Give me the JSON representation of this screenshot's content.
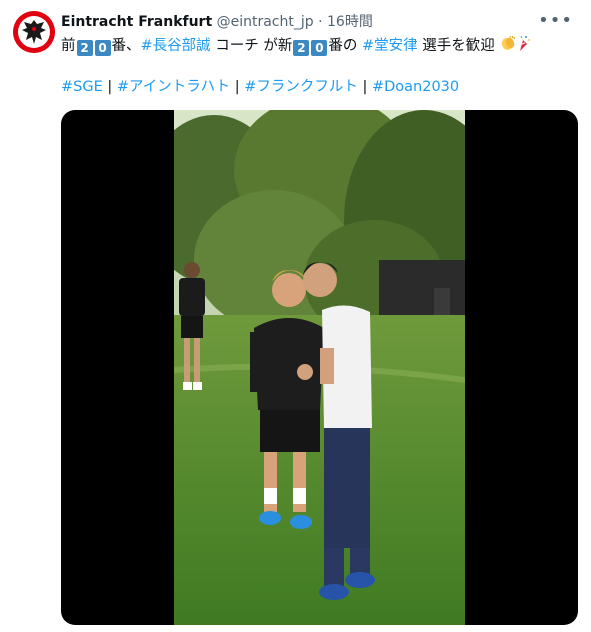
{
  "tweet": {
    "author_name": "Eintracht Frankfurt",
    "author_handle": "@eintracht_jp",
    "separator": "·",
    "timestamp": "16時間",
    "text": {
      "p1": "前",
      "n1a": "2",
      "n1b": "0",
      "p2": "番、",
      "tag1": "#長谷部誠",
      "p3": " コーチ が新",
      "n2a": "2",
      "n2b": "0",
      "p4": "番の ",
      "tag2": "#堂安律",
      "p5": " 選手を歓迎"
    },
    "hashtags": [
      "#SGE",
      "#アイントラハト",
      "#フランクフルト",
      "#Doan2030"
    ],
    "hashtag_separator": " | "
  },
  "icons": {
    "avatar": "eintracht-eagle-logo",
    "more": "more-options-icon",
    "emoji_clap": "clapping-hands-emoji",
    "emoji_party": "party-popper-emoji"
  },
  "colors": {
    "link": "#1d9bf0",
    "brand_red": "#e1000f",
    "keycap": "#3b88c3",
    "secondary_text": "#536471"
  },
  "media": {
    "type": "video"
  }
}
